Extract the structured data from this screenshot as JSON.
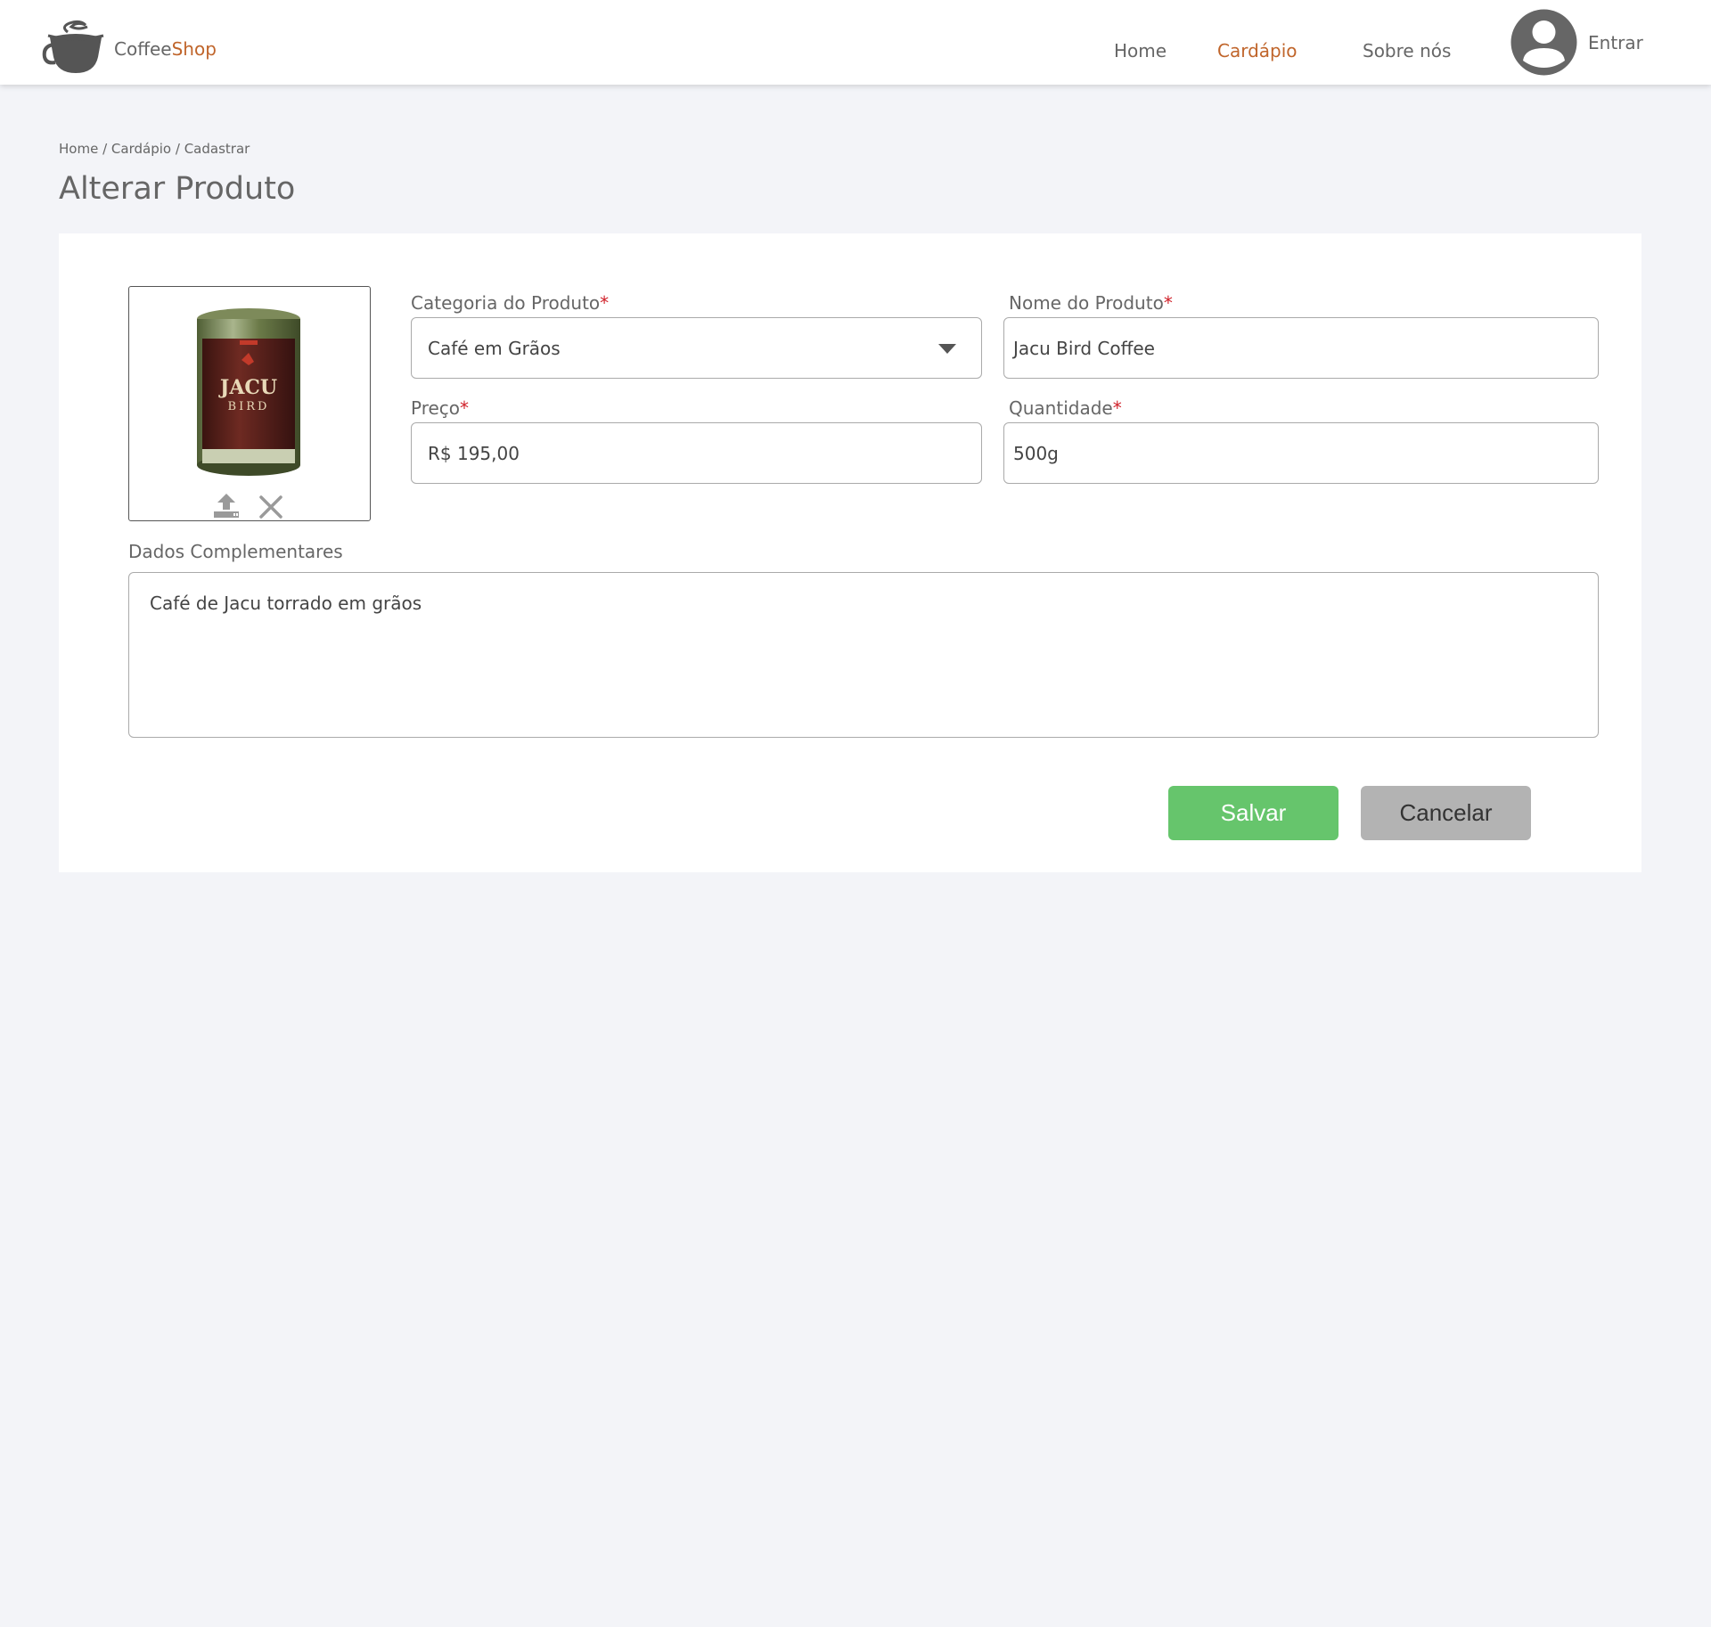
{
  "header": {
    "brand_primary": "Coffee",
    "brand_accent": "Shop",
    "nav": [
      {
        "label": "Home"
      },
      {
        "label": "Cardápio"
      },
      {
        "label": "Sobre nós"
      }
    ],
    "login_label": "Entrar",
    "active_nav": "Cardápio"
  },
  "breadcrumb": {
    "items": [
      "Home",
      "Cardápio",
      "Cadastrar"
    ],
    "separator": "/"
  },
  "page_title": "Alterar Produto",
  "form": {
    "image": {
      "upload_icon": "upload-icon",
      "remove_icon": "close-icon"
    },
    "category": {
      "label": "Categoria do Produto",
      "required_mark": "*",
      "value": "Café em Grãos"
    },
    "name": {
      "label": "Nome do Produto",
      "required_mark": "*",
      "value": "Jacu Bird Coffee"
    },
    "price": {
      "label": "Preço",
      "required_mark": "*",
      "value": "R$ 195,00"
    },
    "quantity": {
      "label": "Quantidade",
      "required_mark": "*",
      "value": "500g"
    },
    "details": {
      "label": "Dados Complementares",
      "value": "Café de Jacu torrado em grãos"
    },
    "save_label": "Salvar",
    "cancel_label": "Cancelar"
  },
  "colors": {
    "accent": "#c0652b",
    "save": "#66c56c",
    "cancel": "#b3b3b3",
    "required": "#d0212a",
    "background": "#f3f4f8"
  }
}
